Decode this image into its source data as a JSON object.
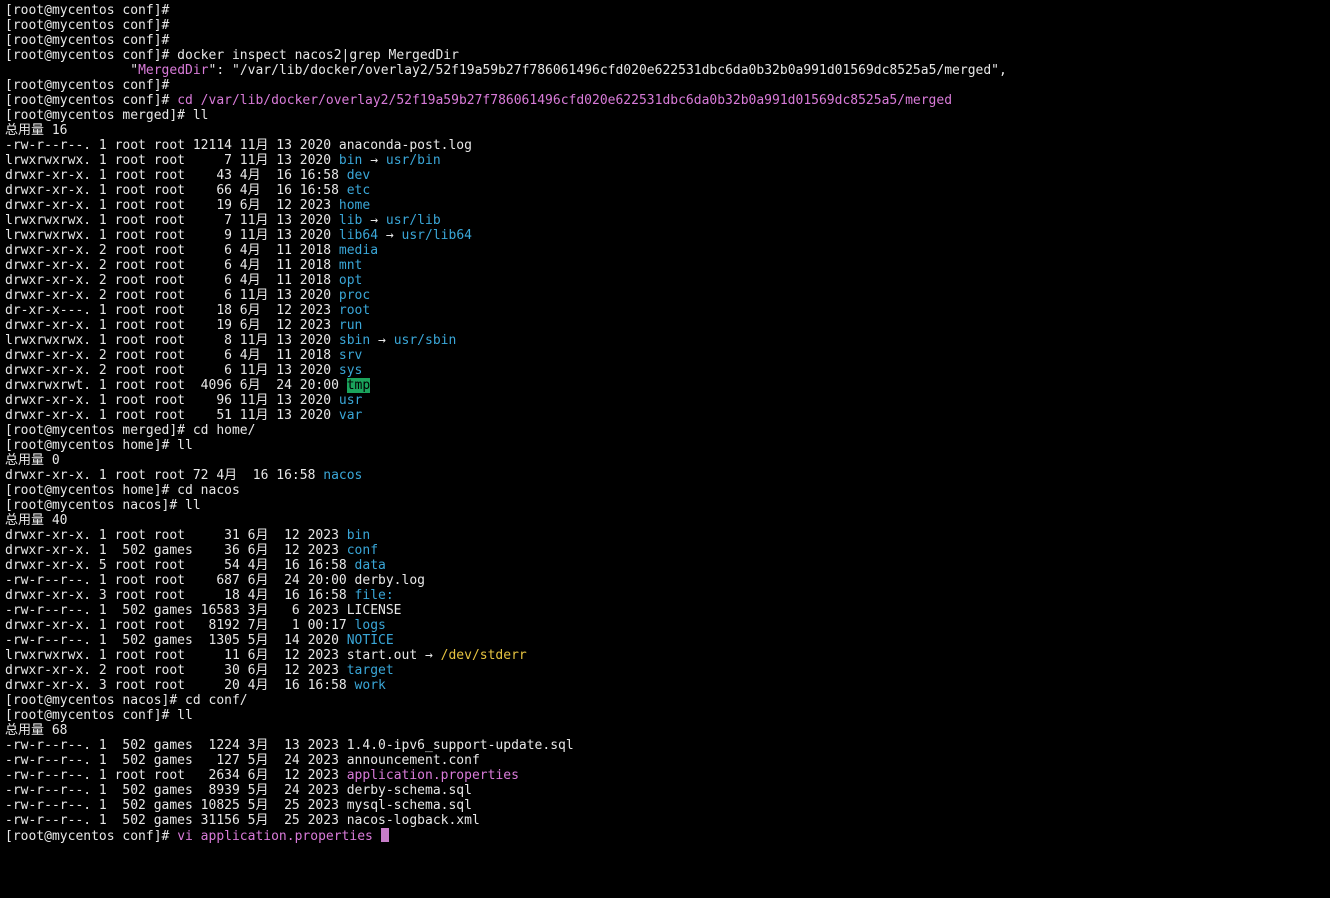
{
  "colors": {
    "background": "#000000",
    "default": "#e8e8e8",
    "directory": "#3aa7d8",
    "symlink_target": "#3aa7d8",
    "magenta": "#d97bd9",
    "yellow": "#e6c340",
    "sticky_dir_bg": "#1aa35c",
    "sticky_dir_fg": "#000000",
    "cursor": "#c77dc8"
  },
  "terminal": {
    "lines": [
      [
        {
          "t": "[root@mycentos conf]#"
        }
      ],
      [
        {
          "t": "[root@mycentos conf]#"
        }
      ],
      [
        {
          "t": "[root@mycentos conf]#"
        }
      ],
      [
        {
          "t": "[root@mycentos conf]# docker inspect nacos2|grep MergedDir"
        }
      ],
      [
        {
          "t": "                \""
        },
        {
          "t": "MergedDir",
          "c": "magenta"
        },
        {
          "t": "\": \"/var/lib/docker/overlay2/52f19a59b27f786061496cfd020e622531dbc6da0b32b0a991d01569dc8525a5/merged\","
        }
      ],
      [
        {
          "t": "[root@mycentos conf]#"
        }
      ],
      [
        {
          "t": "[root@mycentos conf]# "
        },
        {
          "t": "cd /var/lib/docker/overlay2/52f19a59b27f786061496cfd020e622531dbc6da0b32b0a991d01569dc8525a5/merged",
          "c": "magenta"
        }
      ],
      [
        {
          "t": "[root@mycentos merged]# ll"
        }
      ],
      [
        {
          "t": "总用量 16"
        }
      ],
      [
        {
          "t": "-rw-r--r--. 1 root root 12114 11月 13 2020 anaconda-post.log"
        }
      ],
      [
        {
          "t": "lrwxrwxrwx. 1 root root     7 11月 13 2020 "
        },
        {
          "t": "bin",
          "c": "directory"
        },
        {
          "t": " → "
        },
        {
          "t": "usr/bin",
          "c": "symlink_target"
        }
      ],
      [
        {
          "t": "drwxr-xr-x. 1 root root    43 4月  16 16:58 "
        },
        {
          "t": "dev",
          "c": "directory"
        }
      ],
      [
        {
          "t": "drwxr-xr-x. 1 root root    66 4月  16 16:58 "
        },
        {
          "t": "etc",
          "c": "directory"
        }
      ],
      [
        {
          "t": "drwxr-xr-x. 1 root root    19 6月  12 2023 "
        },
        {
          "t": "home",
          "c": "directory"
        }
      ],
      [
        {
          "t": "lrwxrwxrwx. 1 root root     7 11月 13 2020 "
        },
        {
          "t": "lib",
          "c": "directory"
        },
        {
          "t": " → "
        },
        {
          "t": "usr/lib",
          "c": "symlink_target"
        }
      ],
      [
        {
          "t": "lrwxrwxrwx. 1 root root     9 11月 13 2020 "
        },
        {
          "t": "lib64",
          "c": "directory"
        },
        {
          "t": " → "
        },
        {
          "t": "usr/lib64",
          "c": "symlink_target"
        }
      ],
      [
        {
          "t": "drwxr-xr-x. 2 root root     6 4月  11 2018 "
        },
        {
          "t": "media",
          "c": "directory"
        }
      ],
      [
        {
          "t": "drwxr-xr-x. 2 root root     6 4月  11 2018 "
        },
        {
          "t": "mnt",
          "c": "directory"
        }
      ],
      [
        {
          "t": "drwxr-xr-x. 2 root root     6 4月  11 2018 "
        },
        {
          "t": "opt",
          "c": "directory"
        }
      ],
      [
        {
          "t": "drwxr-xr-x. 2 root root     6 11月 13 2020 "
        },
        {
          "t": "proc",
          "c": "directory"
        }
      ],
      [
        {
          "t": "dr-xr-x---. 1 root root    18 6月  12 2023 "
        },
        {
          "t": "root",
          "c": "directory"
        }
      ],
      [
        {
          "t": "drwxr-xr-x. 1 root root    19 6月  12 2023 "
        },
        {
          "t": "run",
          "c": "directory"
        }
      ],
      [
        {
          "t": "lrwxrwxrwx. 1 root root     8 11月 13 2020 "
        },
        {
          "t": "sbin",
          "c": "directory"
        },
        {
          "t": " → "
        },
        {
          "t": "usr/sbin",
          "c": "symlink_target"
        }
      ],
      [
        {
          "t": "drwxr-xr-x. 2 root root     6 4月  11 2018 "
        },
        {
          "t": "srv",
          "c": "directory"
        }
      ],
      [
        {
          "t": "drwxr-xr-x. 2 root root     6 11月 13 2020 "
        },
        {
          "t": "sys",
          "c": "directory"
        }
      ],
      [
        {
          "t": "drwxrwxrwt. 1 root root  4096 6月  24 20:00 "
        },
        {
          "t": "tmp",
          "c": "sticky_dir_fg",
          "bg": "sticky_dir_bg"
        }
      ],
      [
        {
          "t": "drwxr-xr-x. 1 root root    96 11月 13 2020 "
        },
        {
          "t": "usr",
          "c": "directory"
        }
      ],
      [
        {
          "t": "drwxr-xr-x. 1 root root    51 11月 13 2020 "
        },
        {
          "t": "var",
          "c": "directory"
        }
      ],
      [
        {
          "t": "[root@mycentos merged]# cd home/"
        }
      ],
      [
        {
          "t": "[root@mycentos home]# ll"
        }
      ],
      [
        {
          "t": "总用量 0"
        }
      ],
      [
        {
          "t": "drwxr-xr-x. 1 root root 72 4月  16 16:58 "
        },
        {
          "t": "nacos",
          "c": "directory"
        }
      ],
      [
        {
          "t": "[root@mycentos home]# cd nacos"
        }
      ],
      [
        {
          "t": "[root@mycentos nacos]# ll"
        }
      ],
      [
        {
          "t": "总用量 40"
        }
      ],
      [
        {
          "t": "drwxr-xr-x. 1 root root     31 6月  12 2023 "
        },
        {
          "t": "bin",
          "c": "directory"
        }
      ],
      [
        {
          "t": "drwxr-xr-x. 1  502 games    36 6月  12 2023 "
        },
        {
          "t": "conf",
          "c": "directory"
        }
      ],
      [
        {
          "t": "drwxr-xr-x. 5 root root     54 4月  16 16:58 "
        },
        {
          "t": "data",
          "c": "directory"
        }
      ],
      [
        {
          "t": "-rw-r--r--. 1 root root    687 6月  24 20:00 derby.log"
        }
      ],
      [
        {
          "t": "drwxr-xr-x. 3 root root     18 4月  16 16:58 "
        },
        {
          "t": "file:",
          "c": "directory"
        }
      ],
      [
        {
          "t": "-rw-r--r--. 1  502 games 16583 3月   6 2023 LICENSE"
        }
      ],
      [
        {
          "t": "drwxr-xr-x. 1 root root   8192 7月   1 00:17 "
        },
        {
          "t": "logs",
          "c": "directory"
        }
      ],
      [
        {
          "t": "-rw-r--r--. 1  502 games  1305 5月  14 2020 "
        },
        {
          "t": "NOTICE",
          "c": "directory"
        }
      ],
      [
        {
          "t": "lrwxrwxrwx. 1 root root     11 6月  12 2023 start.out → "
        },
        {
          "t": "/dev/stderr",
          "c": "yellow"
        }
      ],
      [
        {
          "t": "drwxr-xr-x. 2 root root     30 6月  12 2023 "
        },
        {
          "t": "target",
          "c": "directory"
        }
      ],
      [
        {
          "t": "drwxr-xr-x. 3 root root     20 4月  16 16:58 "
        },
        {
          "t": "work",
          "c": "directory"
        }
      ],
      [
        {
          "t": "[root@mycentos nacos]# cd conf/"
        }
      ],
      [
        {
          "t": "[root@mycentos conf]# ll"
        }
      ],
      [
        {
          "t": "总用量 68"
        }
      ],
      [
        {
          "t": "-rw-r--r--. 1  502 games  1224 3月  13 2023 1.4.0-ipv6_support-update.sql"
        }
      ],
      [
        {
          "t": "-rw-r--r--. 1  502 games   127 5月  24 2023 announcement.conf"
        }
      ],
      [
        {
          "t": "-rw-r--r--. 1 root root   2634 6月  12 2023 "
        },
        {
          "t": "application.properties",
          "c": "magenta"
        }
      ],
      [
        {
          "t": "-rw-r--r--. 1  502 games  8939 5月  24 2023 derby-schema.sql"
        }
      ],
      [
        {
          "t": "-rw-r--r--. 1  502 games 10825 5月  25 2023 mysql-schema.sql"
        }
      ],
      [
        {
          "t": "-rw-r--r--. 1  502 games 31156 5月  25 2023 nacos-logback.xml"
        }
      ],
      [
        {
          "t": "[root@mycentos conf]# "
        },
        {
          "t": "vi application.properties",
          "c": "magenta"
        },
        {
          "t": " "
        },
        {
          "cursor": true
        }
      ]
    ]
  }
}
